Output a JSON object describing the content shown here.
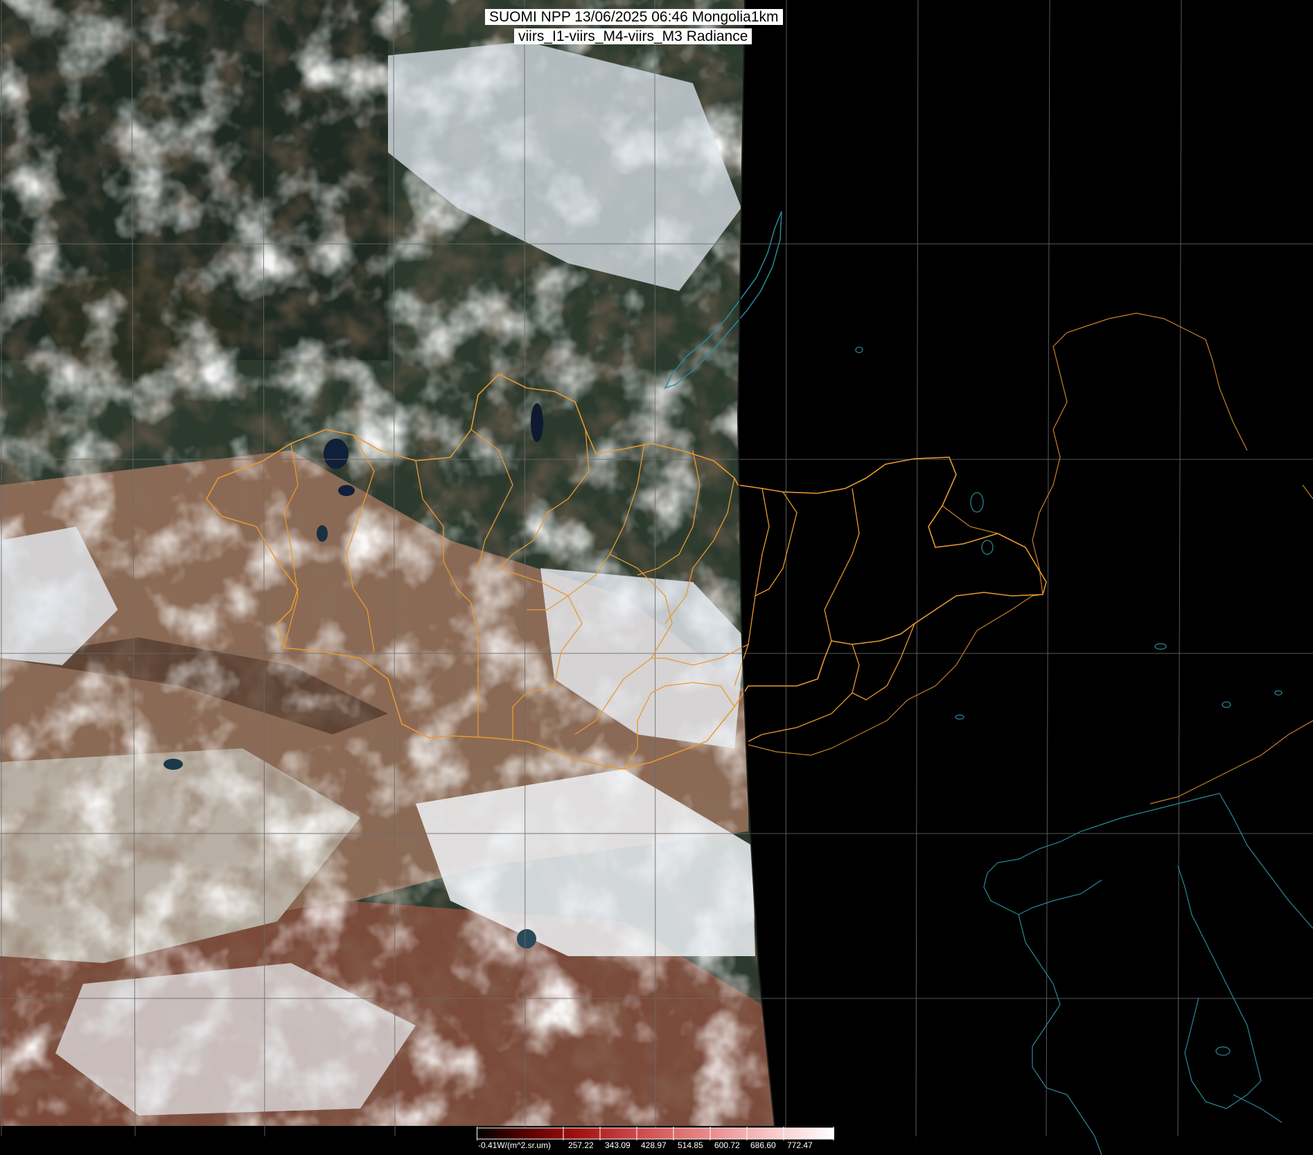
{
  "title": {
    "line1": "SUOMI NPP 13/06/2025 06:46 Mongolia1km",
    "line2": "viirs_I1-viirs_M4-viirs_M3 Radiance"
  },
  "colorbar": {
    "unit_label": "-0.41W/(m^2.sr.um)",
    "ticks": [
      "257.22",
      "343.09",
      "428.97",
      "514.85",
      "600.72",
      "686.60",
      "772.47"
    ],
    "colors": [
      "#000000",
      "#5a0000",
      "#a01010",
      "#c84040",
      "#e07070",
      "#f0a0a0",
      "#f8d0d0",
      "#ffffff"
    ]
  },
  "map": {
    "background_color": "#000000",
    "swath_color": "#3a4a3a",
    "cloud_color": "#e8eef4",
    "desert_color": "#9a7a60",
    "border_color": "#e89a30",
    "coast_color": "#2a8a9a",
    "grid_color": "#6a6a6a"
  }
}
